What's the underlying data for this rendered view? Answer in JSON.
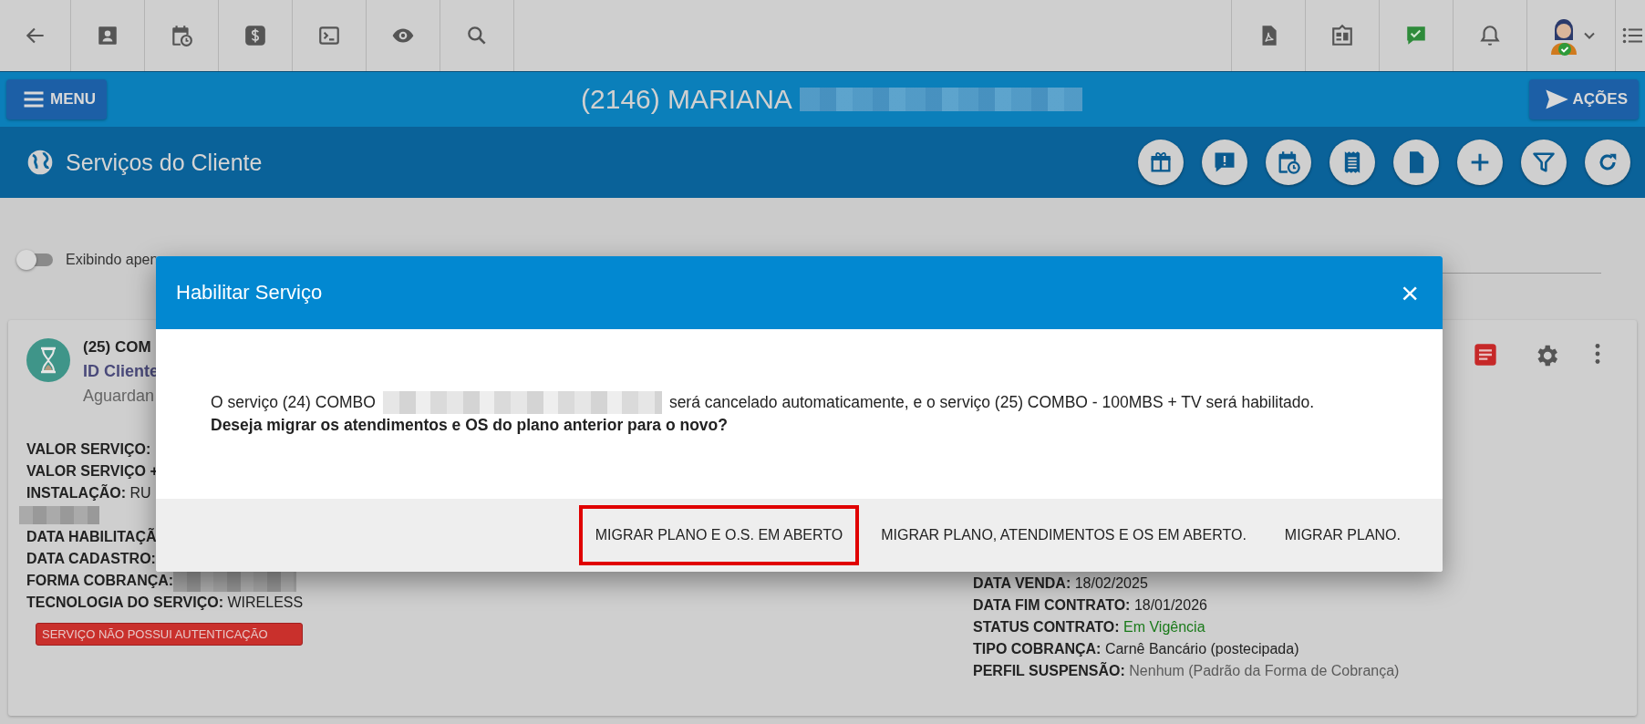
{
  "header": {
    "menu_button": "MENU",
    "client_title": "(2146) MARIANA",
    "actions_button": "AÇÕES"
  },
  "section": {
    "title": "Serviços do Cliente"
  },
  "filter": {
    "toggle_label": "Exibindo apen",
    "on": false
  },
  "service_card": {
    "name": "(25) COM",
    "id_label": "ID Cliente",
    "status": "Aguardan",
    "fields_left": [
      {
        "kind": "field",
        "label": "VALOR SERVIÇO:"
      },
      {
        "kind": "field",
        "label": "VALOR SERVIÇO +"
      },
      {
        "kind": "field",
        "label": "INSTALAÇÃO:",
        "value": "RU"
      },
      {
        "kind": "blurred"
      },
      {
        "kind": "field",
        "label": "DATA HABILITAÇÃ"
      },
      {
        "kind": "field",
        "label": "DATA CADASTRO:"
      },
      {
        "kind": "field_blurred",
        "label": "FORMA COBRANÇA:"
      },
      {
        "kind": "field",
        "label": "TECNOLOGIA DO SERVIÇO:",
        "value": "WIRELESS"
      }
    ],
    "badge": "SERVIÇO NÃO POSSUI AUTENTICAÇÃO",
    "fields_right": [
      {
        "label": "DATA VENDA:",
        "value": "18/02/2025",
        "color": "#222222"
      },
      {
        "label": "DATA FIM CONTRATO:",
        "value": "18/01/2026",
        "color": "#222222"
      },
      {
        "label": "STATUS CONTRATO:",
        "value": "Em Vigência",
        "color": "#1a7a1a"
      },
      {
        "label": "TIPO COBRANÇA:",
        "value": "Carnê Bancário (postecipada)",
        "color": "#222222"
      },
      {
        "label": "PERFIL SUSPENSÃO:",
        "value": "Nenhum (Padrão da Forma de Cobrança)",
        "color": "#5a5a5a"
      }
    ]
  },
  "dialog": {
    "title": "Habilitar Serviço",
    "close": "×",
    "message_start": "O serviço (24) COMBO",
    "message_end": "será cancelado automaticamente, e o serviço (25) COMBO - 100MBS + TV será habilitado.",
    "question": "Deseja migrar os atendimentos e OS do plano anterior para o novo?",
    "buttons": [
      {
        "label": "MIGRAR PLANO E O.S. EM ABERTO",
        "highlighted": true
      },
      {
        "label": "MIGRAR PLANO, ATENDIMENTOS E OS EM ABERTO.",
        "highlighted": false
      },
      {
        "label": "MIGRAR PLANO.",
        "highlighted": false
      }
    ]
  }
}
